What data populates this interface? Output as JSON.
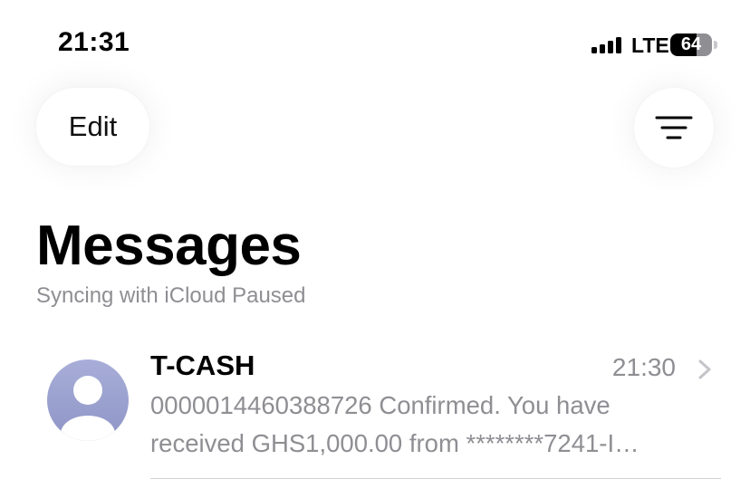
{
  "status_bar": {
    "time": "21:31",
    "network": "LTE",
    "battery_level": "64"
  },
  "toolbar": {
    "edit_label": "Edit",
    "filter_icon": "filter-lines-icon"
  },
  "header": {
    "title": "Messages",
    "subtitle": "Syncing with iCloud Paused"
  },
  "conversations": [
    {
      "sender": "T-CASH",
      "time": "21:30",
      "preview_line1": "0000014460388726 Confirmed. You have",
      "preview_line2": "received GHS1,000.00 from ********7241-I…",
      "avatar_icon": "person-icon"
    }
  ],
  "colors": {
    "secondary_text": "#8e8e93",
    "avatar_top": "#a8aed8",
    "avatar_bottom": "#8e95c6",
    "separator": "#d1d1d6"
  }
}
